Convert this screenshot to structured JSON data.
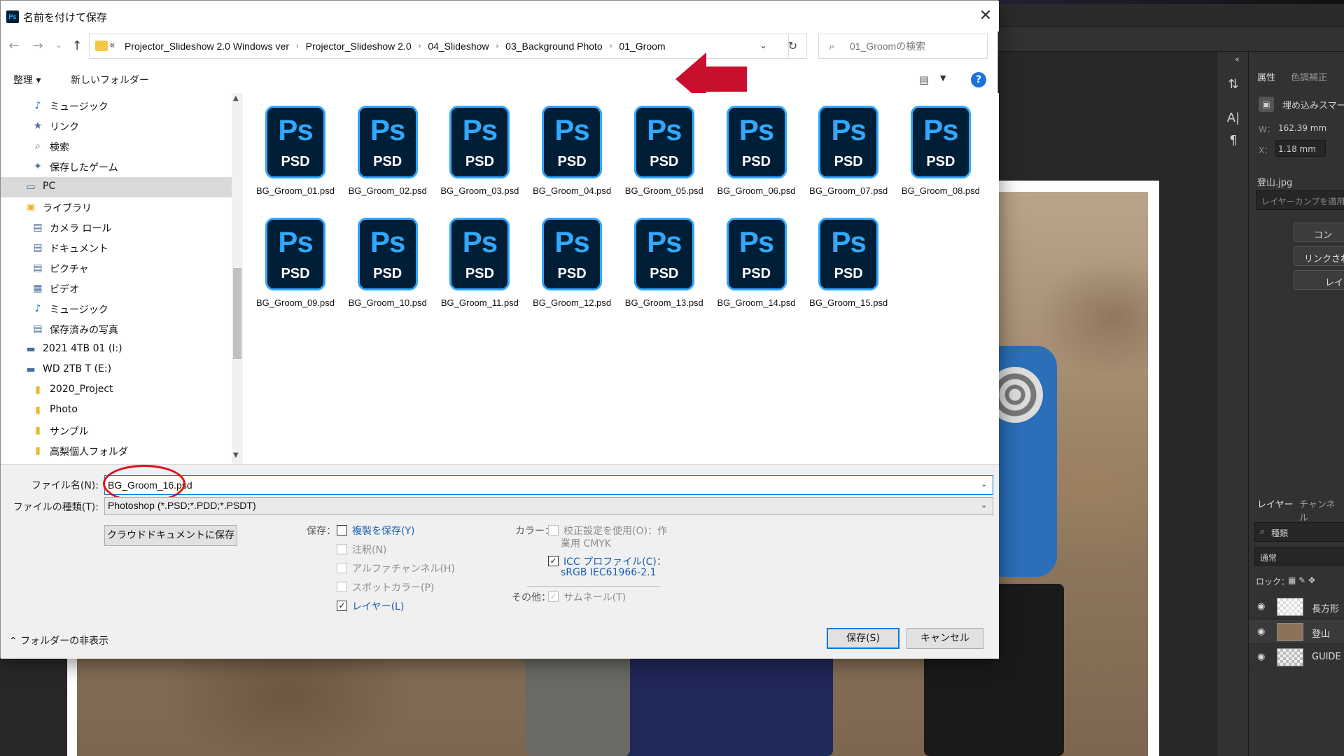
{
  "dialog": {
    "title": "名前を付けて保存",
    "close_glyph": "✕",
    "app_icon_text": "Ps"
  },
  "navigation": {
    "back_glyph": "←",
    "forward_glyph": "→",
    "history_glyph": "⌄",
    "up_glyph": "↑",
    "overflow_glyph": "«",
    "breadcrumbs": [
      "Projector_Slideshow 2.0 Windows ver",
      "Projector_Slideshow 2.0",
      "04_Slideshow",
      "03_Background Photo",
      "01_Groom"
    ],
    "separator_glyph": "›",
    "dropdown_glyph": "⌄",
    "refresh_glyph": "↻",
    "search_placeholder": "01_Groomの検索",
    "search_glyph": "⌕"
  },
  "toolbar": {
    "organize_label": "整理 ▾",
    "new_folder_label": "新しいフォルダー",
    "view_glyph": "▤",
    "view_dropdown_glyph": "▼",
    "help_glyph": "?"
  },
  "sidebar": {
    "items": [
      {
        "label": "ミュージック",
        "icon": "♪",
        "indent": 1
      },
      {
        "label": "リンク",
        "icon": "★",
        "indent": 1
      },
      {
        "label": "検索",
        "icon": "⌕",
        "indent": 1
      },
      {
        "label": "保存したゲーム",
        "icon": "✦",
        "indent": 1
      },
      {
        "label": "PC",
        "icon": "▭",
        "indent": 0,
        "selected": true
      },
      {
        "label": "ライブラリ",
        "icon": "▣",
        "indent": 0
      },
      {
        "label": "カメラ ロール",
        "icon": "▤",
        "indent": 1
      },
      {
        "label": "ドキュメント",
        "icon": "▤",
        "indent": 1
      },
      {
        "label": "ピクチャ",
        "icon": "▤",
        "indent": 1
      },
      {
        "label": "ビデオ",
        "icon": "▦",
        "indent": 1
      },
      {
        "label": "ミュージック",
        "icon": "♪",
        "indent": 1
      },
      {
        "label": "保存済みの写真",
        "icon": "▤",
        "indent": 1
      },
      {
        "label": "2021 4TB 01 (I:)",
        "icon": "▬",
        "indent": 0
      },
      {
        "label": "WD 2TB T (E:)",
        "icon": "▬",
        "indent": 0
      },
      {
        "label": "2020_Project",
        "icon": "▮",
        "indent": 1
      },
      {
        "label": "Photo",
        "icon": "▮",
        "indent": 1
      },
      {
        "label": "サンプル",
        "icon": "▮",
        "indent": 1
      },
      {
        "label": "高梨個人フォルダ",
        "icon": "▮",
        "indent": 1
      }
    ],
    "scroll_up_glyph": "▲",
    "scroll_down_glyph": "▼"
  },
  "files": {
    "icon_ps": "Ps",
    "icon_psd": "PSD",
    "items": [
      "BG_Groom_01.psd",
      "BG_Groom_02.psd",
      "BG_Groom_03.psd",
      "BG_Groom_04.psd",
      "BG_Groom_05.psd",
      "BG_Groom_06.psd",
      "BG_Groom_07.psd",
      "BG_Groom_08.psd",
      "BG_Groom_09.psd",
      "BG_Groom_10.psd",
      "BG_Groom_11.psd",
      "BG_Groom_12.psd",
      "BG_Groom_13.psd",
      "BG_Groom_14.psd",
      "BG_Groom_15.psd"
    ]
  },
  "form": {
    "filename_label": "ファイル名(N):",
    "filename_value": "BG_Groom_16.psd",
    "filetype_label": "ファイルの種類(T):",
    "filetype_value": "Photoshop (*.PSD;*.PDD;*.PSDT)",
    "dropdown_glyph": "⌄",
    "cloud_button": "クラウドドキュメントに保存",
    "save_group_label": "保存：",
    "save_options": [
      {
        "label": "複製を保存(Y)",
        "checked": false,
        "enabled": true
      },
      {
        "label": "注釈(N)",
        "checked": false,
        "enabled": false
      },
      {
        "label": "アルファチャンネル(H)",
        "checked": false,
        "enabled": false
      },
      {
        "label": "スポットカラー(P)",
        "checked": false,
        "enabled": false
      },
      {
        "label": "レイヤー(L)",
        "checked": true,
        "enabled": true
      }
    ],
    "color_group_label": "カラー：",
    "proof_line1": "校正設定を使用(O)：作",
    "proof_line2": "業用 CMYK",
    "icc_line1": "ICC プロファイル(C)：",
    "icc_line2": "sRGB IEC61966-2.1",
    "other_group_label": "その他：",
    "thumbnail_label": "サムネール(T)",
    "check_glyph": "✓",
    "hide_folders": "⌃  フォルダーの非表示",
    "save_button": "保存(S)",
    "cancel_button": "キャンセル"
  },
  "photoshop": {
    "collapse_glyph": "«",
    "properties_tab": "属性",
    "adjustments_tab": "色調補正",
    "smart_object_label": "埋め込みスマー",
    "width_label": "W：",
    "width_value": "162.39 mm",
    "x_label": "X：",
    "x_value": "1.18 mm",
    "file_label": "登山.jpg",
    "comps_placeholder": "レイヤーカンプを適用",
    "button_1": "コン",
    "button_2": "リンクされ",
    "button_3": "レイ",
    "layers_tab": "レイヤー",
    "channels_tab": "チャンネル",
    "kind_label": "種類",
    "blend_mode": "通常",
    "lock_label": "ロック：",
    "lock_glyphs": "▦  ✎  ✥",
    "eye_glyph": "◉",
    "layers": [
      "長方形",
      "登山",
      "GUIDE"
    ],
    "strip_icons": [
      "⇅",
      "A|",
      "¶"
    ]
  }
}
